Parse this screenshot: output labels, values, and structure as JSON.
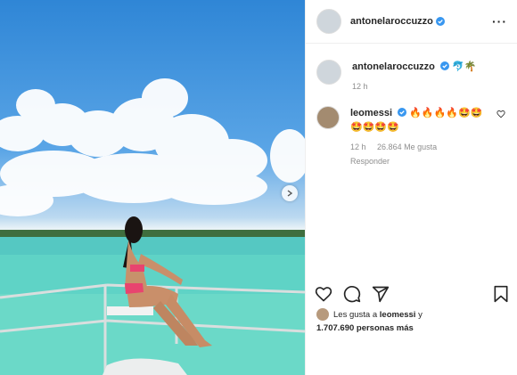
{
  "header": {
    "username": "antonelaroccuzzo",
    "more_label": "···"
  },
  "caption": {
    "username": "antonelaroccuzzo",
    "emojis": "🐬🌴",
    "time": "12 h"
  },
  "comment": {
    "username": "leomessi",
    "text": "🔥🔥🔥🔥🤩🤩🤩🤩🤩🤩",
    "time": "12 h",
    "likes": "26.864 Me gusta",
    "reply": "Responder"
  },
  "likes": {
    "prefix": "Les gusta a",
    "user": "leomessi",
    "conj": "y",
    "count": "1.707.690 personas más"
  },
  "icons": [
    "verified-icon",
    "more-icon",
    "next-arrow-icon",
    "heart-icon",
    "comment-icon",
    "share-icon",
    "bookmark-icon"
  ]
}
